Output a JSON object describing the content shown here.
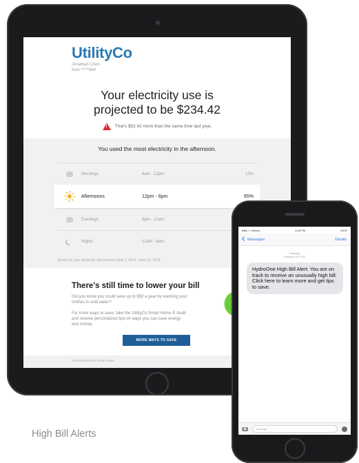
{
  "email": {
    "brand": "UtilityCo",
    "recipient_name": "Jonathan Chen",
    "recipient_account": "Acct *****594",
    "headline_line1": "Your electricity use is",
    "headline_line2": "projected to be $234.42",
    "comparison_text": "That's $52.42 more than the same time last year.",
    "usage_title": "You used the most electricity in the afternoon.",
    "usage_rows": [
      {
        "label": "Mornings",
        "time": "6am - 12pm",
        "pct": "13%"
      },
      {
        "label": "Afternoons",
        "time": "12pm - 6pm",
        "pct": "65%"
      },
      {
        "label": "Evenings",
        "time": "6pm - 12am",
        "pct": "20%"
      },
      {
        "label": "Nights",
        "time": "12am - 6am",
        "pct": "2%"
      }
    ],
    "highlight_row": "Afternoons",
    "usage_footnote": "Based on your electricity use between April 1, 2014 - April 15, 2014.",
    "savings_title": "There's still time to lower your bill",
    "savings_body1": "Did you know you could save up to $50 a year by washing your clothes in cold water?",
    "savings_body2": "For more ways to save, take the UtilityCo Smart Home E-Audit and receive personalized tips on ways you can save energy and money.",
    "cta_label": "MORE WAYS TO SAVE",
    "footer_text": "Unsubscribe from these emails",
    "pie_fraction_light": 0.1
  },
  "phone": {
    "carrier": "●●●○○ Verizon",
    "clock": "4:48 PM",
    "battery": "100%",
    "back_label": "Messages",
    "details_label": "Details",
    "msg_label": "Message",
    "msg_time": "Monday 4:21 PM",
    "message_text": "HydroOne High Bill Alert: You are on track to receive an unusually high bill. Click here to learn more and get tips to save.",
    "input_placeholder": "Message"
  },
  "caption": "High Bill Alerts",
  "colors": {
    "brand_blue": "#2a79b4",
    "cta_blue": "#1f5f99",
    "warning_red": "#d9312b",
    "sun_yellow": "#f1b325",
    "pie_green": "#6ccb3d",
    "ios_blue": "#2a7bf5"
  }
}
